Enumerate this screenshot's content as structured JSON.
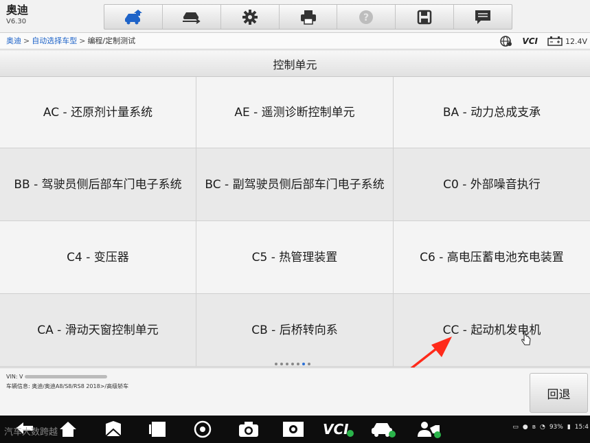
{
  "header": {
    "brand": "奥迪",
    "version": "V6.30"
  },
  "toolbar": {
    "buttons": [
      {
        "icon": "home-car-icon"
      },
      {
        "icon": "vehicle-swap-icon"
      },
      {
        "icon": "settings-gear-icon"
      },
      {
        "icon": "print-icon"
      },
      {
        "icon": "help-icon"
      },
      {
        "icon": "save-icon"
      },
      {
        "icon": "message-icon"
      }
    ]
  },
  "breadcrumb": {
    "items": [
      "奥迪",
      "自动选择车型",
      "编程/定制测试"
    ],
    "separator": ">"
  },
  "status": {
    "vci": "VCI",
    "voltage": "12.4V"
  },
  "section_title": "控制单元",
  "modules": [
    "AC - 还原剂计量系统",
    "AE - 遥测诊断控制单元",
    "BA - 动力总成支承",
    "BB - 驾驶员侧后部车门电子系统",
    "BC - 副驾驶员侧后部车门电子系统",
    "C0 - 外部噪音执行",
    "C4 - 变压器",
    "C5 - 热管理装置",
    "C6 - 高电压蓄电池充电装置",
    "CA - 滑动天窗控制单元",
    "CB - 后桥转向系",
    "CC - 起动机发电机"
  ],
  "pagination": {
    "total": 7,
    "current": 6
  },
  "info": {
    "vin_label": "VIN: V",
    "vehicle": "车辆信息: 奥迪/奥迪A8/S8/RS8 2018>/高级轿车"
  },
  "back_button": "回退",
  "navbar": {
    "watermark": "汽车大数跨越",
    "vci_label": "VCI",
    "battery": "93%",
    "time": "15:4"
  },
  "colors": {
    "accent": "#2a6fd6",
    "link": "#1e63c8",
    "annotation": "#ff2a1a"
  }
}
